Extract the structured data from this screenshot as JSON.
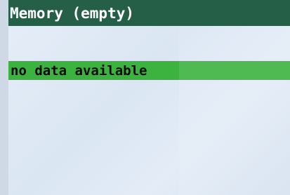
{
  "header": {
    "title": "Memory (empty)"
  },
  "list": {
    "message": "no data available"
  },
  "colors": {
    "title_bar": "#255f47",
    "highlight": "#3db33f",
    "background": "#e2eaf5",
    "title_text": "#ffffff",
    "row_text": "#0a0a0a"
  }
}
